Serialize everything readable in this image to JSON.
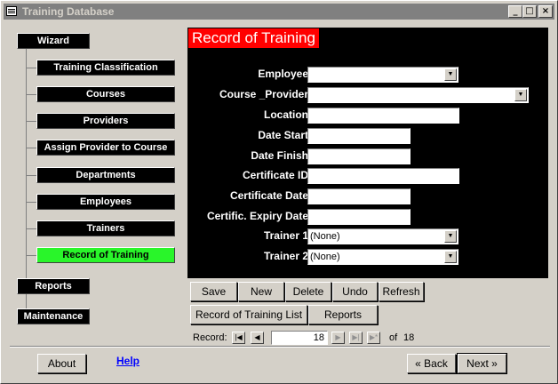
{
  "window": {
    "title": "Training Database",
    "controls": {
      "minimize": "_",
      "maximize": "□",
      "close": "×"
    }
  },
  "sidebar": {
    "wizard_label": "Wizard",
    "items": [
      {
        "label": "Training Classification"
      },
      {
        "label": "Courses"
      },
      {
        "label": "Providers"
      },
      {
        "label": "Assign Provider to Course"
      },
      {
        "label": "Departments"
      },
      {
        "label": "Employees"
      },
      {
        "label": "Trainers"
      },
      {
        "label": "Record of Training",
        "active": true
      }
    ],
    "reports_label": "Reports",
    "maintenance_label": "Maintenance"
  },
  "form": {
    "title": "Record of Training",
    "fields": {
      "employee": {
        "label": "Employee:",
        "value": ""
      },
      "course_provider": {
        "label": "Course _Provider:",
        "value": ""
      },
      "location": {
        "label": "Location:",
        "value": ""
      },
      "date_start": {
        "label": "Date Start:",
        "value": ""
      },
      "date_finish": {
        "label": "Date Finish:",
        "value": ""
      },
      "certificate_id": {
        "label": "Certificate ID:",
        "value": ""
      },
      "certificate_date": {
        "label": "Certificate Date:",
        "value": ""
      },
      "expiry_date": {
        "label": "Certific. Expiry Date:",
        "value": ""
      },
      "trainer1": {
        "label": "Trainer 1:",
        "value": "(None)"
      },
      "trainer2": {
        "label": "Trainer 2:",
        "value": "(None)"
      }
    }
  },
  "actions": {
    "save": "Save",
    "new": "New",
    "delete": "Delete",
    "undo": "Undo",
    "refresh": "Refresh",
    "record_list": "Record of Training List",
    "reports": "Reports"
  },
  "record_nav": {
    "label": "Record:",
    "current": "18",
    "of_label": "of",
    "total": "18",
    "icons": [
      "first-record-icon",
      "previous-record-icon",
      "next-record-icon",
      "last-record-icon",
      "new-record-icon"
    ]
  },
  "footer": {
    "about": "About",
    "help": "Help",
    "back": "« Back",
    "next": "Next »",
    "help_color": "#0000ff"
  },
  "colors": {
    "panel_bg": "#000000",
    "title_bg": "#ff0000",
    "active_nav_bg": "#29f52a"
  }
}
